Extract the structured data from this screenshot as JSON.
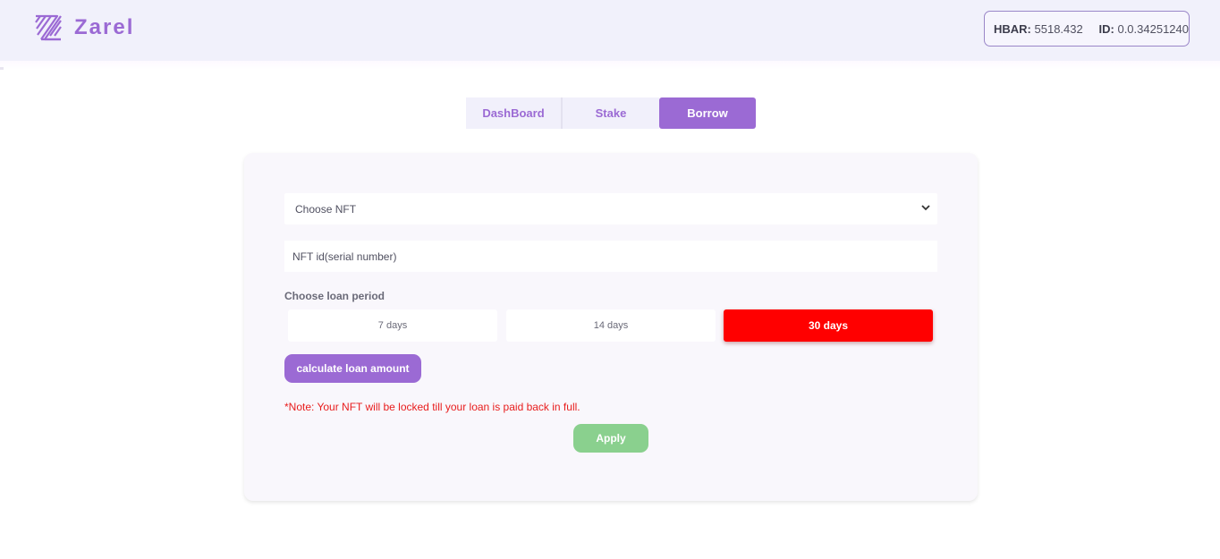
{
  "brand": {
    "name": "Zarel",
    "color": "#9b6ad4"
  },
  "wallet": {
    "hbar_label": "HBAR:",
    "hbar_value": "5518.432",
    "id_label": "ID:",
    "id_value": "0.0.34251240"
  },
  "tabs": [
    {
      "label": "DashBoard",
      "active": false
    },
    {
      "label": "Stake",
      "active": false
    },
    {
      "label": "Borrow",
      "active": true
    }
  ],
  "form": {
    "nft_select": {
      "value": "Choose NFT",
      "icon": "chevron-down-icon"
    },
    "nft_id": {
      "placeholder": "NFT id(serial number)",
      "value": ""
    },
    "period_label": "Choose loan period",
    "periods": [
      {
        "label": "7 days",
        "selected": false
      },
      {
        "label": "14 days",
        "selected": false
      },
      {
        "label": "30 days",
        "selected": true
      }
    ],
    "calculate_label": "calculate loan amount",
    "note": "*Note: Your NFT will be locked till your loan is paid back in full.",
    "apply_label": "Apply"
  },
  "colors": {
    "accent": "#9b6ad4",
    "selected_period": "#ff0000",
    "note": "#e81d1d",
    "apply": "#8ad08e",
    "header_bg": "#f1f1fb"
  }
}
